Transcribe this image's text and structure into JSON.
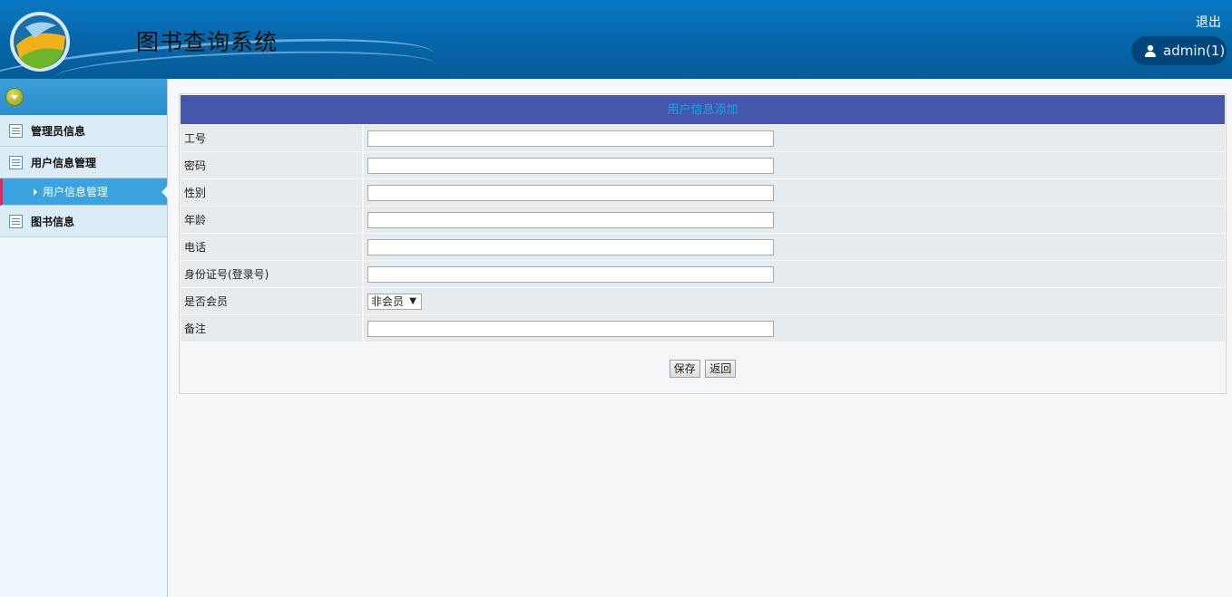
{
  "header": {
    "title": "图书查询系统",
    "logout": "退出",
    "user": "admin(1)"
  },
  "sidebar": {
    "items": [
      {
        "label": "管理员信息"
      },
      {
        "label": "用户信息管理"
      },
      {
        "label": "用户信息管理"
      },
      {
        "label": "图书信息"
      }
    ]
  },
  "form": {
    "title": "用户信息添加",
    "fields": [
      {
        "label": "工号",
        "value": ""
      },
      {
        "label": "密码",
        "value": ""
      },
      {
        "label": "性别",
        "value": ""
      },
      {
        "label": "年龄",
        "value": ""
      },
      {
        "label": "电话",
        "value": ""
      },
      {
        "label": "身份证号(登录号)",
        "value": ""
      },
      {
        "label": "是否会员",
        "selected": "非会员"
      },
      {
        "label": "备注",
        "value": ""
      }
    ],
    "save": "保存",
    "back": "返回"
  }
}
